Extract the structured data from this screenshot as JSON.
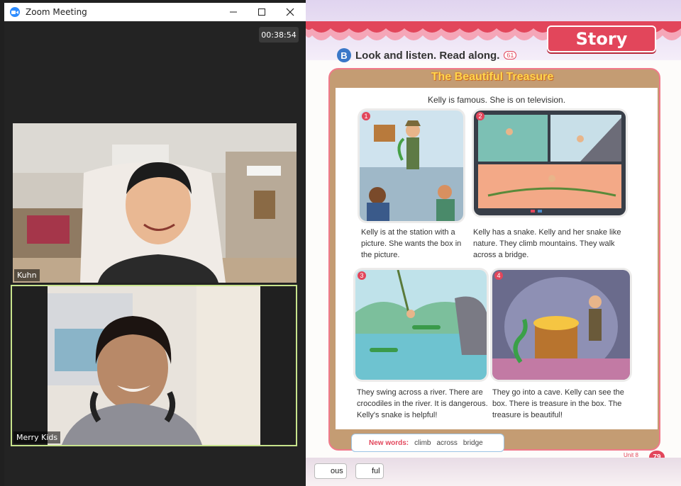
{
  "zoom": {
    "window_title": "Zoom Meeting",
    "timer": "00:38:54",
    "participants": [
      {
        "name": "Kuhn"
      },
      {
        "name": "Merry Kids"
      }
    ],
    "active_speaker_color": "#c7e38c"
  },
  "book": {
    "banner": "Story",
    "section_letter": "B",
    "instruction": "Look and listen. Read along.",
    "audio_track": "61",
    "story_title": "The Beautiful Treasure",
    "subtitle": "Kelly is famous. She is on television.",
    "panels": [
      {
        "number": "1",
        "caption": "Kelly is at the station with a picture. She wants the box in the picture."
      },
      {
        "number": "2",
        "caption": "Kelly has a snake. Kelly and her snake like nature. They climb mountains. They walk across a bridge."
      },
      {
        "number": "3",
        "caption": "They swing across a river. There are crocodiles in the river. It is dangerous. Kelly's snake is helpful!"
      },
      {
        "number": "4",
        "caption": "They go into a cave. Kelly can see the box. There is treasure in the box. The treasure is beautiful!"
      }
    ],
    "new_words_label": "New words:",
    "new_words": [
      "climb",
      "across",
      "bridge"
    ],
    "suffix_chips": [
      "ous",
      "ful"
    ],
    "unit_label": "Unit 8",
    "page_number": "79",
    "accent_color": "#e2465b"
  }
}
